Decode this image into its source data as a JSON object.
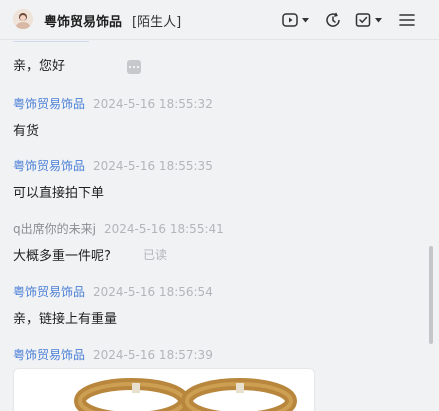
{
  "header": {
    "contact_name": "粤饰贸易饰品",
    "contact_tag": "[陌生人]",
    "icons": [
      "video-call-icon",
      "dropdown-icon",
      "history-icon",
      "task-icon",
      "dropdown-icon",
      "menu-icon"
    ]
  },
  "messages": [
    {
      "text": "亲，您好"
    },
    {
      "sender": "粤饰贸易饰品",
      "time": "2024-5-16 18:55:32",
      "text": "有货"
    },
    {
      "sender": "粤饰贸易饰品",
      "time": "2024-5-16 18:55:35",
      "text": "可以直接拍下单"
    },
    {
      "sender": "q出席你的未来j",
      "time": "2024-5-16 18:55:41",
      "text": "大概多重一件呢?",
      "status": "已读"
    },
    {
      "sender": "粤饰贸易饰品",
      "time": "2024-5-16 18:56:54",
      "text": "亲，链接上有重量"
    },
    {
      "sender": "粤饰贸易饰品",
      "time": "2024-5-16 18:57:39"
    }
  ],
  "colors": {
    "shop_sender": "#4a7fd6",
    "user_sender": "#8a8d93",
    "timestamp": "#b3b5b9",
    "background": "#f1f2f4"
  }
}
